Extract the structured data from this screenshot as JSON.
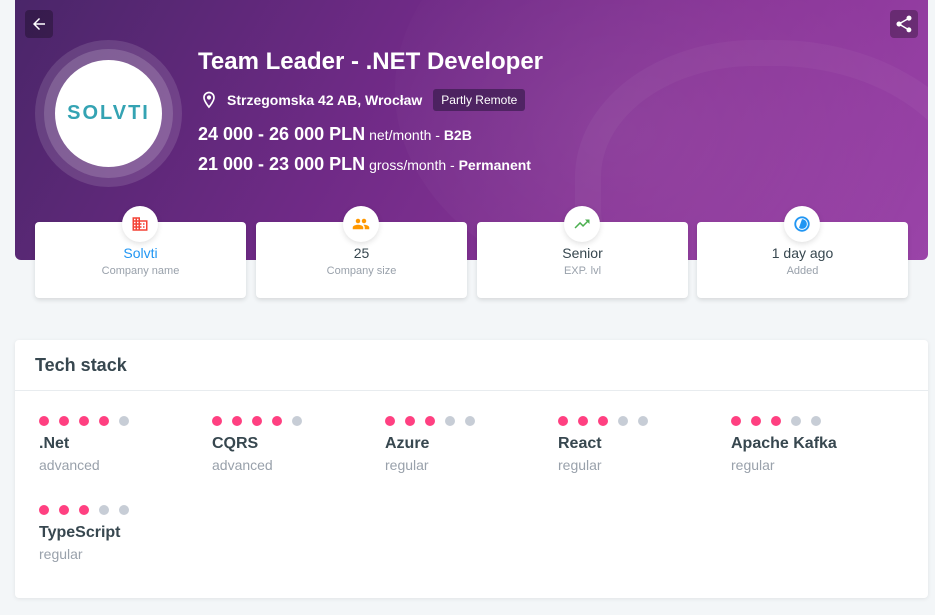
{
  "header": {
    "title": "Team Leader - .NET Developer",
    "address": "Strzegomska 42 AB, Wrocław",
    "remote_badge": "Partly Remote",
    "logo_text": "SOLVTI",
    "salaries": [
      {
        "amount": "24 000 - 26 000 PLN",
        "period": "net/month - ",
        "type": "B2B"
      },
      {
        "amount": "21 000 - 23 000 PLN",
        "period": "gross/month - ",
        "type": "Permanent"
      }
    ]
  },
  "cards": [
    {
      "value": "Solvti",
      "label": "Company name",
      "icon": "building-icon",
      "color": "#f44336"
    },
    {
      "value": "25",
      "label": "Company size",
      "icon": "people-icon",
      "color": "#ff9800"
    },
    {
      "value": "Senior",
      "label": "EXP. lvl",
      "icon": "trending-up-icon",
      "color": "#4caf50"
    },
    {
      "value": "1 day ago",
      "label": "Added",
      "icon": "clock-icon",
      "color": "#2196f3"
    }
  ],
  "tech_stack": {
    "title": "Tech stack",
    "skills": [
      {
        "name": ".Net",
        "level": "advanced",
        "dots": 4
      },
      {
        "name": "CQRS",
        "level": "advanced",
        "dots": 4
      },
      {
        "name": "Azure",
        "level": "regular",
        "dots": 3
      },
      {
        "name": "React",
        "level": "regular",
        "dots": 3
      },
      {
        "name": "Apache Kafka",
        "level": "regular",
        "dots": 3
      },
      {
        "name": "TypeScript",
        "level": "regular",
        "dots": 3
      }
    ]
  },
  "colors": {
    "accent": "#ff4081",
    "hero": "#7b2d8f",
    "link": "#2196f3"
  }
}
